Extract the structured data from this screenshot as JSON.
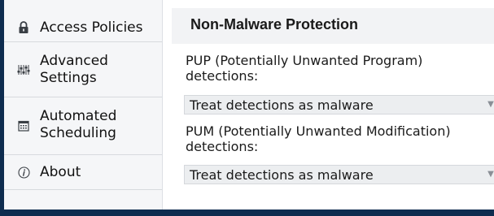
{
  "sidebar": {
    "items": [
      {
        "label": "Access Policies",
        "icon": "lock-icon"
      },
      {
        "label": "Advanced\nSettings",
        "icon": "sliders-icon"
      },
      {
        "label": "Automated\nScheduling",
        "icon": "calendar-icon"
      },
      {
        "label": "About",
        "icon": "info-icon"
      }
    ]
  },
  "main": {
    "section_title": "Non-Malware Protection",
    "pup": {
      "label": "PUP (Potentially Unwanted Program) detections:",
      "value": "Treat detections as malware"
    },
    "pum": {
      "label": "PUM (Potentially Unwanted Modification) detections:",
      "value": "Treat detections as malware"
    }
  },
  "colors": {
    "window_border": "#0e2c4f",
    "sidebar_bg": "#f5f6f8",
    "header_bg": "#f2f3f5",
    "select_bg": "#eceef0"
  }
}
